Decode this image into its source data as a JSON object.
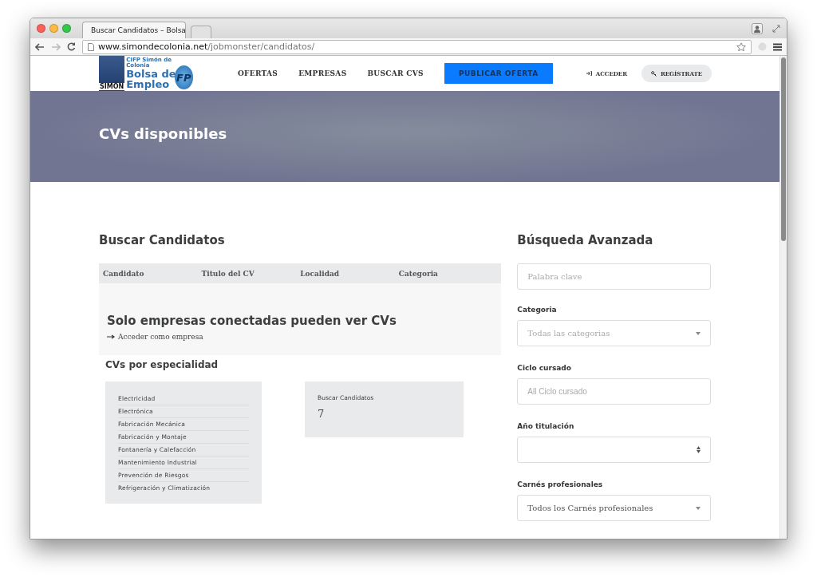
{
  "browser": {
    "tab_title": "Buscar Candidatos – Bolsa",
    "url_domain": "www.simondecolonia.net",
    "url_path": "/jobmonster/candidatos/"
  },
  "header": {
    "logo": {
      "school": "CIFP Simón de Colonia",
      "line_1": "Bolsa de",
      "line_2": "Empleo",
      "mark": "SIMÓN",
      "badge": "FP"
    },
    "nav": [
      {
        "label": "OFERTAS",
        "kind": "link"
      },
      {
        "label": "EMPRESAS",
        "kind": "link"
      },
      {
        "label": "BUSCAR CVS",
        "kind": "link"
      },
      {
        "label": "PUBLICAR OFERTA",
        "kind": "primary"
      }
    ],
    "account": [
      {
        "label": "ACCEDER",
        "kind": "login"
      },
      {
        "label": "REGÍSTRATE",
        "kind": "register"
      }
    ]
  },
  "hero": {
    "title": "CVs disponibles"
  },
  "main": {
    "title": "Buscar Candidatos",
    "columns": [
      "Candidato",
      "Titulo del CV",
      "Localidad",
      "Categoria"
    ],
    "notice": {
      "title": "Solo empresas conectadas pueden ver CVs",
      "link": "Acceder como empresa"
    },
    "specialty_title": "CVs por especialidad",
    "specialties": [
      "Electricidad",
      "Electrónica",
      "Fabricación Mecánica",
      "Fabricación y Montaje",
      "Fontanería y Calefacción",
      "Mantenimiento Industrial",
      "Prevención de Riesgos",
      "Refrigeración y Climatización"
    ],
    "stat": {
      "label": "Buscar Candidatos",
      "value": "7"
    }
  },
  "sidebar": {
    "title": "Búsqueda Avanzada",
    "keyword_placeholder": "Palabra clave",
    "fields": [
      {
        "label": "Categoria",
        "kind": "select",
        "placeholder": "Todas las categorias"
      },
      {
        "label": "Ciclo cursado",
        "kind": "input",
        "placeholder": "All Ciclo cursado"
      },
      {
        "label": "Año titulación",
        "kind": "spinner"
      },
      {
        "label": "Carnés profesionales",
        "kind": "select",
        "value": "Todos los Carnés profesionales"
      }
    ]
  }
}
